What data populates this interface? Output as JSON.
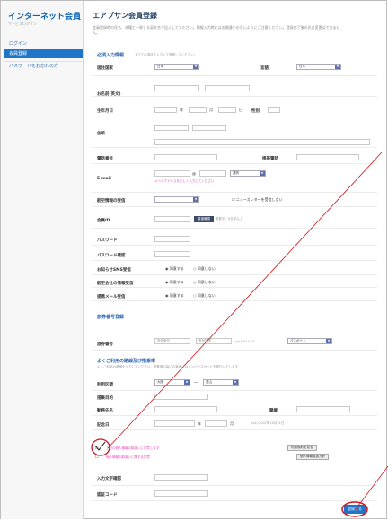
{
  "sidebar": {
    "brand": "インターネット会員",
    "brand_sub": "サービスログイン",
    "items": [
      {
        "label": "ログイン",
        "active": false
      },
      {
        "label": "会員登録",
        "active": true
      },
      {
        "label": "パスワードをお忘れの方",
        "active": false
      }
    ]
  },
  "page": {
    "title": "エアプサン会員登録",
    "description": "会員登録時の氏名、本籍と一致する英文名で記入してください。情報入力時にはお間違いのないようにご注意ください。登録完了後の氏名変更はできません。"
  },
  "section_basic": {
    "title": "必須入力情報",
    "note": "すべての項目を入力して登録してください。"
  },
  "fields": {
    "country_label": "居住国家",
    "country_value": "日本",
    "lang_label": "言語",
    "lang_value": "日本",
    "name_label": "お名前(英文)",
    "birth_label": "生年月日",
    "birth_year": "年",
    "birth_month": "月",
    "birth_day": "日",
    "gender_label": "性別",
    "address_label": "住所",
    "phone_label": "電話番号",
    "mobile_label": "携帯電話",
    "email_label": "E-mail",
    "email_domain": "選択",
    "email_hint": "メールアドレスを正しく入力してください",
    "newsletter_label": "航空情報の受信",
    "newsletter_option": "ニュースレターを受信しない",
    "id_label": "会員ID",
    "id_check_button": "重複確認",
    "id_hint": "英数字、6文字以上",
    "pw_label": "パスワード",
    "pw_confirm_label": "パスワード確認",
    "sms_label": "お知らせSMS受信",
    "mail_label": "航空会社の情報受信",
    "dm_label": "提携メール受信",
    "agree": "同意する",
    "disagree": "同意しない"
  },
  "section_passport": {
    "title": "旅券番号登録",
    "passport_label": "旅券番号",
    "passport_placeholder": "旅券番号",
    "expiry_placeholder": "有効期限",
    "passport_example": "(ex)2014.10",
    "type_value": "パスポート"
  },
  "section_optional": {
    "title": "よくご利用の路線及び搭乗率",
    "note": "よくご利用の路線を入力してください。搭乗率の高いお客様にはメンバーズカードを発行いたします。",
    "route_label": "利用区間",
    "route_from": "大阪",
    "route_to": "釜山",
    "purpose_label": "搭乗目的",
    "company_label": "勤務先名",
    "job_label": "職業",
    "anniversary_label": "記念日",
    "anniversary_example": "(ex) 2007年10月31日",
    "year": "年",
    "month": "月"
  },
  "consent": {
    "agree_text": "上記の個人情報の取扱いに同意します",
    "terms_button": "利用規約を見る",
    "privacy_text": "個人情報の取扱いに関する同意",
    "privacy_button": "個人情報取扱方針"
  },
  "final": {
    "captcha_label": "入力文字確認",
    "code_label": "認証コード",
    "submit_label": "登録する"
  },
  "colors": {
    "accent": "#1f76c9",
    "annotation": "#d0141c"
  }
}
